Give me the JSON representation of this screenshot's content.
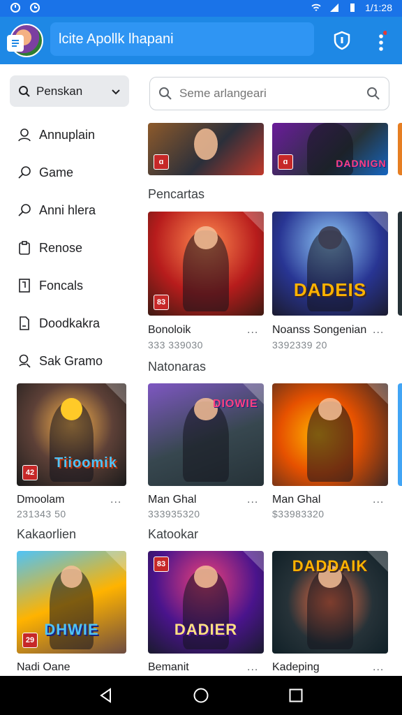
{
  "status": {
    "time": "1/1:28"
  },
  "appbar": {
    "title": "lcite Apollk lhapani"
  },
  "nav": {
    "filter_label": "Penskan",
    "items": [
      {
        "label": "Annuplain",
        "icon": "user-icon"
      },
      {
        "label": "Game",
        "icon": "search-icon"
      },
      {
        "label": "Anni hlera",
        "icon": "search-icon"
      },
      {
        "label": "Renose",
        "icon": "clipboard-icon"
      },
      {
        "label": "Foncals",
        "icon": "document-icon"
      },
      {
        "label": "Doodkakra",
        "icon": "file-icon"
      },
      {
        "label": "Sak Gramo",
        "icon": "search-user-icon"
      }
    ]
  },
  "search": {
    "placeholder": "Seme arlangeari"
  },
  "top_row": {
    "badges": [
      "ɑ",
      "ɑ"
    ],
    "logo2": "DADNIGN"
  },
  "sections": {
    "s1": "Pencartas",
    "s2": "Natonaras",
    "s3a": "Kakaorlien",
    "s3b": "Katookar"
  },
  "games": {
    "g1": {
      "name": "Bonoloik",
      "num": "333 339030",
      "badge": "83",
      "logo": ""
    },
    "g2": {
      "name": "Noanss Songenian",
      "num": "3392339 20",
      "badge": "",
      "logo": "DADEIS"
    },
    "g3": {
      "name": "Dmoolam",
      "num": "231343 50",
      "badge": "42",
      "logo": "Tiioomik"
    },
    "g4": {
      "name": "Man Ghal",
      "num": "333935320",
      "badge": "",
      "logo": "DIOWIE"
    },
    "g5": {
      "name": "Man Ghal",
      "num": "$33983320",
      "badge": "",
      "logo": ""
    },
    "g6": {
      "name": "Nadi Oane",
      "num": "",
      "badge": "29",
      "logo": "DHWIE"
    },
    "g7": {
      "name": "Bemanit",
      "num": "",
      "badge": "83",
      "logo": "DADIER"
    },
    "g8": {
      "name": "Kadeping",
      "num": "",
      "badge": "",
      "logo": "DADDAIK"
    }
  },
  "more_label": "...",
  "colors": {
    "primary": "#1e88e5",
    "status": "#1a73e8",
    "badge": "#c62828"
  }
}
